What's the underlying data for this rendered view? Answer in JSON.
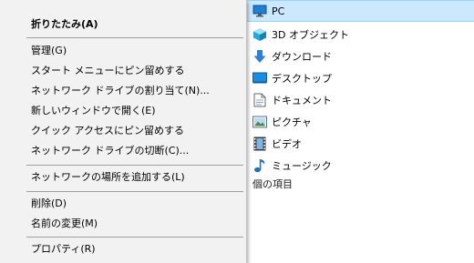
{
  "context_menu": {
    "items": {
      "collapse": "折りたたみ(A)",
      "manage": "管理(G)",
      "pin_to_start": "スタート メニューにピン留めする",
      "map_network_drive": "ネットワーク ドライブの割り当て(N)...",
      "open_new_window": "新しいウィンドウで開く(E)",
      "pin_to_quick_access": "クイック アクセスにピン留めする",
      "disconnect_network_drive": "ネットワーク ドライブの切断(C)...",
      "add_network_location": "ネットワークの場所を追加する(L)",
      "delete": "削除(D)",
      "rename": "名前の変更(M)",
      "properties": "プロパティ(R)"
    }
  },
  "nav_tree": {
    "pc": "PC",
    "objects_3d": "3D オブジェクト",
    "downloads": "ダウンロード",
    "desktop": "デスクトップ",
    "documents": "ドキュメント",
    "pictures": "ピクチャ",
    "videos": "ビデオ",
    "music": "ミュージック"
  },
  "status_bar": {
    "item_count_text": "個の項目"
  },
  "colors": {
    "selection": "#cce8ff",
    "menu_background": "#f2f2f2",
    "accent_blue": "#1e73be"
  }
}
